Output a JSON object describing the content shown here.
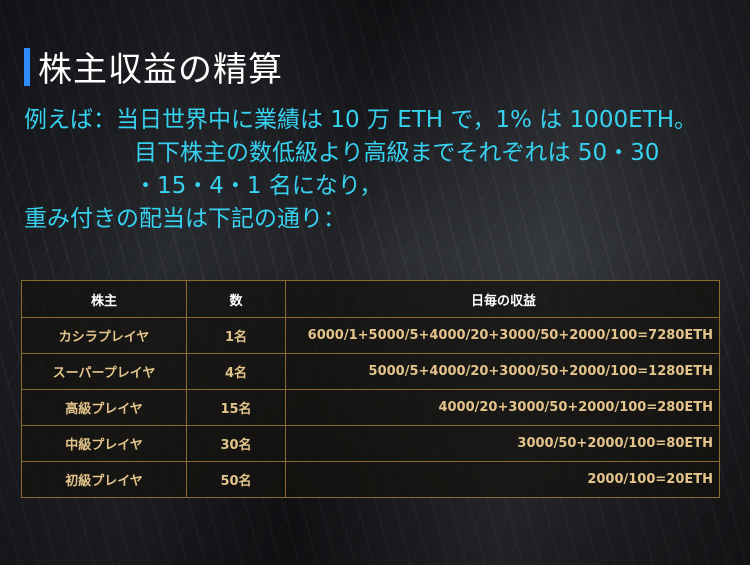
{
  "title": "株主収益の精算",
  "description": {
    "line1": "例えば：当日世界中に業績は 10 万 ETH で，1% は 1000ETH。",
    "line2": "目下株主の数低級より高級までそれぞれは 50・30",
    "line3": "・15・4・1 名になり，",
    "line4": "重み付きの配当は下記の通り："
  },
  "table": {
    "headers": [
      "株主",
      "数",
      "日毎の収益"
    ],
    "rows": [
      [
        "カシラプレイヤ",
        "1名",
        "6000/1+5000/5+4000/20+3000/50+2000/100=7280ETH"
      ],
      [
        "スーパープレイヤ",
        "4名",
        "5000/5+4000/20+3000/50+2000/100=1280ETH"
      ],
      [
        "高級プレイヤ",
        "15名",
        "4000/20+3000/50+2000/100=280ETH"
      ],
      [
        "中級プレイヤ",
        "30名",
        "3000/50+2000/100=80ETH"
      ],
      [
        "初級プレイヤ",
        "50名",
        "2000/100=20ETH"
      ]
    ]
  },
  "colors": {
    "accent_bar": "#2f8cff",
    "description_text": "#36d2f0",
    "table_border": "#8a6a2e",
    "table_cell_text": "#e3c48a"
  }
}
